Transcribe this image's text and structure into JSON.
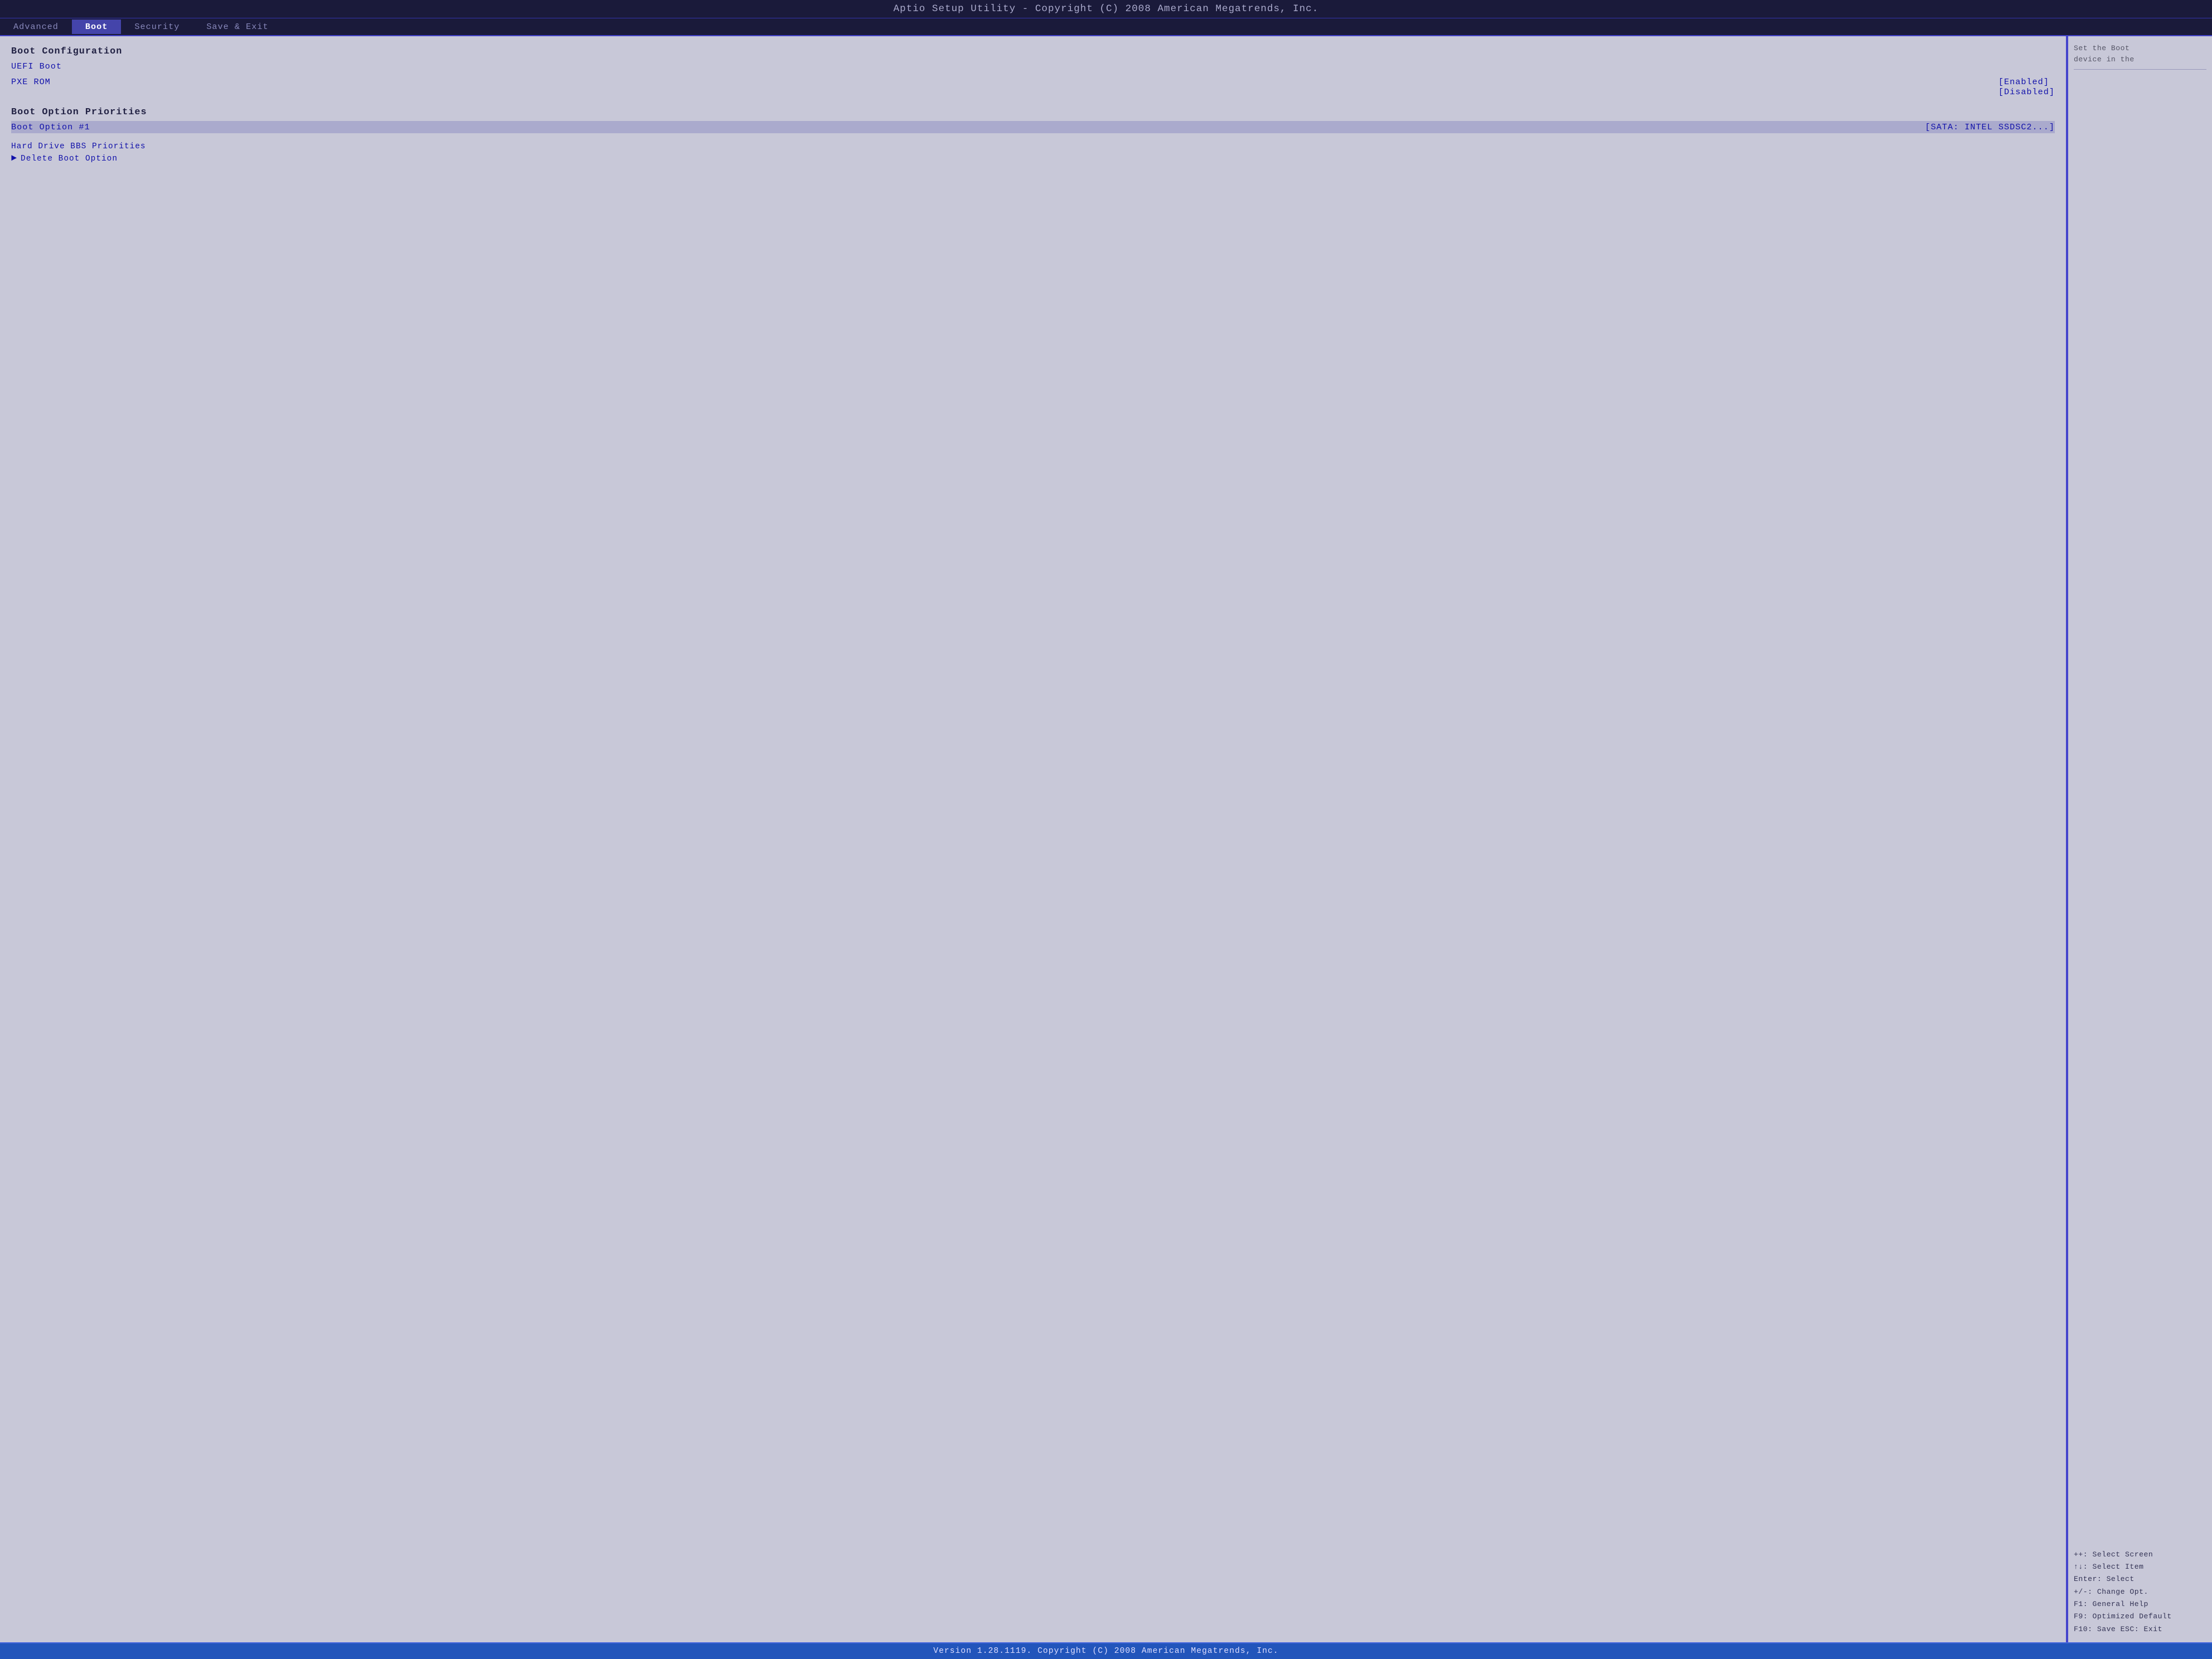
{
  "title_bar": {
    "text": "Aptio Setup Utility - Copyright (C) 2008 American Megatrends, Inc."
  },
  "nav": {
    "items": [
      {
        "label": "Advanced",
        "active": false
      },
      {
        "label": "Boot",
        "active": true
      },
      {
        "label": "Security",
        "active": false
      },
      {
        "label": "Save & Exit",
        "active": false
      }
    ]
  },
  "settings": {
    "section1_header": "Boot Configuration",
    "uefi_boot_label": "UEFI Boot",
    "pxe_rom_label": "PXE ROM",
    "uefi_value": "[Enabled]",
    "pxe_value": "[Disabled]",
    "section2_header": "Boot Option Priorities",
    "boot_option1_label": "Boot Option #1",
    "boot_option1_value": "[SATA: INTEL SSDSC2...]",
    "hard_drive_bbs_label": "Hard Drive BBS Priorities",
    "delete_boot_label": "Delete Boot Option"
  },
  "help": {
    "top_text": "Set the Boot\ndevice in the",
    "keys": [
      "++: Select Screen",
      "↑↓: Select Item",
      "Enter: Select",
      "+/-: Change Opt.",
      "F1: General Help",
      "F9: Optimized Default",
      "F10: Save  ESC: Exit"
    ]
  },
  "status_bar": {
    "text": "Version 1.28.1119. Copyright (C) 2008 American Megatrends, Inc."
  }
}
